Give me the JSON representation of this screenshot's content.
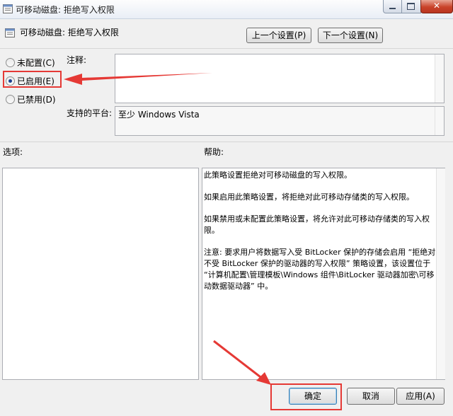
{
  "window": {
    "title": "可移动磁盘: 拒绝写入权限",
    "close_label": "✕"
  },
  "header": {
    "policy_name": "可移动磁盘: 拒绝写入权限",
    "prev_label": "上一个设置(P)",
    "next_label": "下一个设置(N)"
  },
  "state": {
    "options": [
      {
        "label": "未配置(C)",
        "selected": false
      },
      {
        "label": "已启用(E)",
        "selected": true
      },
      {
        "label": "已禁用(D)",
        "selected": false
      }
    ]
  },
  "comment": {
    "label": "注释:",
    "value": ""
  },
  "supported": {
    "label": "支持的平台:",
    "value": "至少 Windows Vista"
  },
  "options_panel": {
    "label": "选项:"
  },
  "help": {
    "label": "帮助:",
    "paragraphs": [
      "此策略设置拒绝对可移动磁盘的写入权限。",
      "如果启用此策略设置，将拒绝对此可移动存储类的写入权限。",
      "如果禁用或未配置此策略设置，将允许对此可移动存储类的写入权限。",
      "注意: 要求用户将数据写入受 BitLocker 保护的存储会启用 “拒绝对不受 BitLocker 保护的驱动器的写入权限” 策略设置，该设置位于 “计算机配置\\管理模板\\Windows 组件\\BitLocker 驱动器加密\\可移动数据驱动器” 中。"
    ]
  },
  "footer": {
    "ok_label": "确定",
    "cancel_label": "取消",
    "apply_label": "应用(A)"
  },
  "colors": {
    "annotation": "#e53935",
    "radio_dot": "#1b3f91",
    "default_button_border": "#3c7fb1"
  }
}
